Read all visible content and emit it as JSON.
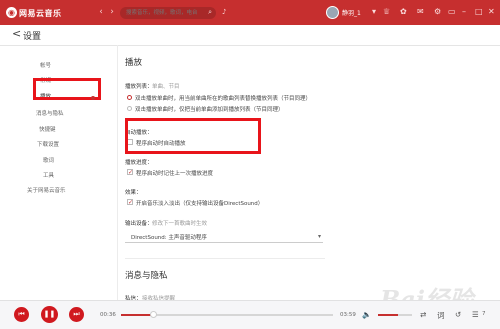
{
  "app": {
    "title": "网易云音乐",
    "logo": "netease-logo",
    "brand_color": "#c62f2f"
  },
  "header": {
    "search_placeholder": "搜索音乐，视频，歌词，电台",
    "username": "静羽_1",
    "window_controls": [
      "minimize",
      "maximize",
      "close"
    ]
  },
  "page": {
    "back_label": "<",
    "title": "设置"
  },
  "sidebar": {
    "items": [
      {
        "label": "帐号"
      },
      {
        "label": "常规"
      },
      {
        "label": "播放",
        "active": true
      },
      {
        "label": "消息与隐私"
      },
      {
        "label": "快捷键"
      },
      {
        "label": "下载设置"
      },
      {
        "label": "歌词"
      },
      {
        "label": "工具"
      },
      {
        "label": "关于网易云音乐"
      }
    ]
  },
  "play_section": {
    "title": "播放",
    "playlist": {
      "label": "播放列表：",
      "hint": "单曲、节目",
      "options": [
        {
          "label": "双击播放单曲时，用当前单曲所在的歌曲列表替换播放列表（节目同理）",
          "selected": true
        },
        {
          "label": "双击播放单曲时，仅把当前单曲添加到播放列表（节目同理）",
          "selected": false
        }
      ]
    },
    "autoplay": {
      "label": "自动播放：",
      "option": "程序启动时自动播放",
      "checked": false
    },
    "progress": {
      "label": "播放进度：",
      "option": "程序启动时记住上一次播放进度",
      "checked": true
    },
    "effect": {
      "label": "效果：",
      "option": "开启音乐淡入淡出（仅支持输出设备DirectSound）",
      "checked": true
    },
    "output": {
      "label": "输出设备：",
      "hint": "修改下一首歌曲时生效",
      "device": "DirectSound: 主声音驱动程序"
    }
  },
  "privacy_section": {
    "title": "消息与隐私",
    "item_label": "私信：",
    "item_hint": "接收私信提醒"
  },
  "player": {
    "current_time": "00:36",
    "total_time": "03:59",
    "progress": 0.15,
    "volume": 0.6,
    "playlist_count": "7"
  },
  "watermark": "Bai经验"
}
